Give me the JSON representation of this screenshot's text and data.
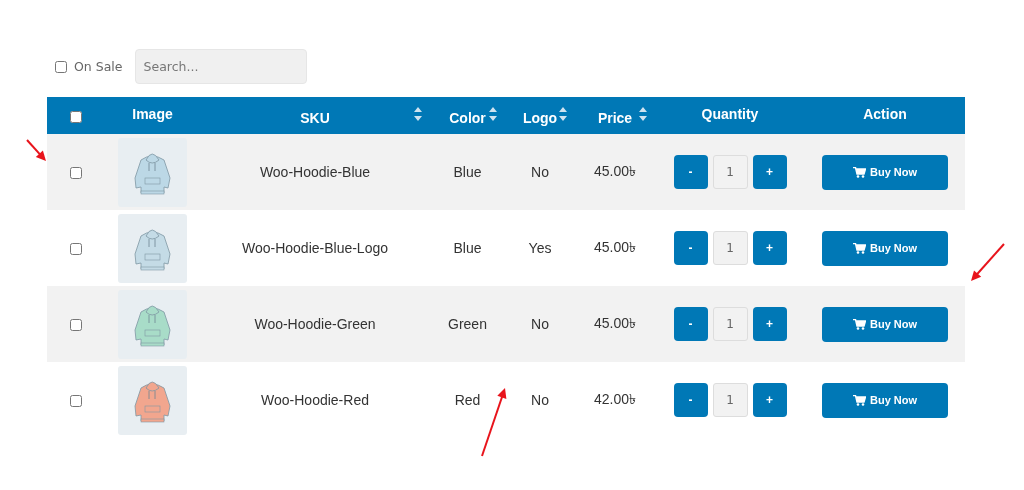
{
  "filters": {
    "on_sale": {
      "label": "On Sale",
      "checked": false
    },
    "search": {
      "placeholder": "Search..."
    }
  },
  "table": {
    "select_all": {
      "checked": false
    },
    "columns": [
      {
        "kind": "select"
      },
      {
        "kind": "plain",
        "label": "Image"
      },
      {
        "kind": "sortable",
        "label": "SKU"
      },
      {
        "kind": "sortable",
        "label": "Color"
      },
      {
        "kind": "sortable",
        "label": "Logo"
      },
      {
        "kind": "sortable",
        "label": "Price"
      },
      {
        "kind": "plain",
        "label": "Quantity"
      },
      {
        "kind": "plain",
        "label": "Action"
      }
    ],
    "rows": [
      {
        "checked": false,
        "sku": "Woo-Hoodie-Blue",
        "color_name": "Blue",
        "logo": "No",
        "price": "45.00৳",
        "quantity": "1",
        "minus": "-",
        "plus": "+",
        "action": "Buy Now"
      },
      {
        "checked": false,
        "sku": "Woo-Hoodie-Blue-Logo",
        "color_name": "Blue",
        "logo": "Yes",
        "price": "45.00৳",
        "quantity": "1",
        "minus": "-",
        "plus": "+",
        "action": "Buy Now"
      },
      {
        "checked": false,
        "sku": "Woo-Hoodie-Green",
        "color_name": "Green",
        "logo": "No",
        "price": "45.00৳",
        "quantity": "1",
        "minus": "-",
        "plus": "+",
        "action": "Buy Now"
      },
      {
        "checked": false,
        "sku": "Woo-Hoodie-Red",
        "color_name": "Red",
        "logo": "No",
        "price": "42.00৳",
        "quantity": "1",
        "minus": "-",
        "plus": "+",
        "action": "Buy Now"
      }
    ]
  },
  "annotations": [
    {
      "kind": "arrow"
    },
    {
      "kind": "arrow"
    },
    {
      "kind": "arrow"
    }
  ]
}
